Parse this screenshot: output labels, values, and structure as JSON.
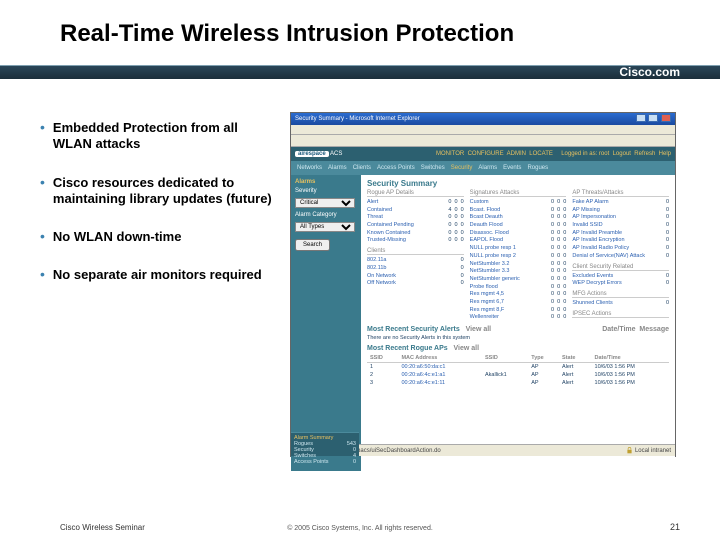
{
  "slide": {
    "title": "Real-Time Wireless Intrusion Protection",
    "cisco_com": "Cisco.com",
    "bullets": [
      "Embedded Protection from all WLAN attacks",
      "Cisco resources dedicated to maintaining library updates (future)",
      "No WLAN down-time",
      "No separate air monitors required"
    ],
    "footer_left": "Cisco Wireless Seminar",
    "footer_center": "© 2005 Cisco Systems, Inc. All rights reserved.",
    "footer_right": "21"
  },
  "screenshot": {
    "window_title": "Security Summary - Microsoft Internet Explorer",
    "brand": "airespace",
    "brand_sub": "ACS",
    "login": "Logged in as: root",
    "logout": "Logout",
    "refresh": "Refresh",
    "help": "Help",
    "topnav": [
      "MONITOR",
      "CONFIGURE",
      "ADMIN",
      "LOCATE"
    ],
    "subnav": [
      "Networks",
      "Alarms",
      "Clients",
      "Access Points",
      "Switches",
      "Security",
      "Alarms",
      "Events",
      "Rogues"
    ],
    "left": {
      "header": "Alarms",
      "severity_label": "Severity",
      "severity_value": "Critical",
      "category_label": "Alarm Category",
      "category_value": "All Types",
      "search": "Search"
    },
    "summary": {
      "title": "Security Summary",
      "col1_hdr": "Rogue AP Details",
      "col2_hdr": "Signatures Attacks",
      "col3_hdr": "AP Threats/Attacks",
      "col1": [
        {
          "l": "Alert",
          "a": "0",
          "b": "0",
          "c": "0"
        },
        {
          "l": "Contained",
          "a": "4",
          "b": "0",
          "c": "0"
        },
        {
          "l": "Threat",
          "a": "0",
          "b": "0",
          "c": "0"
        },
        {
          "l": "Contained Pending",
          "a": "0",
          "b": "0",
          "c": "0"
        },
        {
          "l": "Known Contained",
          "a": "0",
          "b": "0",
          "c": "0"
        },
        {
          "l": "Trusted-Missing",
          "a": "0",
          "b": "0",
          "c": "0"
        }
      ],
      "col1b_hdr": "Clients",
      "col1b": [
        {
          "l": "802.11a",
          "a": "0"
        },
        {
          "l": "802.11b",
          "a": "0"
        },
        {
          "l": "On Network",
          "a": "0"
        },
        {
          "l": "Off Network",
          "a": "0"
        }
      ],
      "col2": [
        {
          "l": "Custom",
          "a": "0",
          "b": "0",
          "c": "0"
        },
        {
          "l": "Bcast. Flood",
          "a": "0",
          "b": "0",
          "c": "0"
        },
        {
          "l": "Bcast Deauth",
          "a": "0",
          "b": "0",
          "c": "0"
        },
        {
          "l": "Deauth Flood",
          "a": "0",
          "b": "0",
          "c": "0"
        },
        {
          "l": "Disassoc. Flood",
          "a": "0",
          "b": "0",
          "c": "0"
        },
        {
          "l": "EAPOL Flood",
          "a": "0",
          "b": "0",
          "c": "0"
        },
        {
          "l": "NULL probe resp 1",
          "a": "0",
          "b": "0",
          "c": "0"
        },
        {
          "l": "NULL probe resp 2",
          "a": "0",
          "b": "0",
          "c": "0"
        },
        {
          "l": "NetStumbler 3.2",
          "a": "0",
          "b": "0",
          "c": "0"
        },
        {
          "l": "NetStumbler 3.3",
          "a": "0",
          "b": "0",
          "c": "0"
        },
        {
          "l": "NetStumbler generic",
          "a": "0",
          "b": "0",
          "c": "0"
        },
        {
          "l": "Probe flood",
          "a": "0",
          "b": "0",
          "c": "0"
        },
        {
          "l": "Res mgmt 4,5",
          "a": "0",
          "b": "0",
          "c": "0"
        },
        {
          "l": "Res mgmt 6,7",
          "a": "0",
          "b": "0",
          "c": "0"
        },
        {
          "l": "Res mgmt 8,F",
          "a": "0",
          "b": "0",
          "c": "0"
        },
        {
          "l": "Wellenreiter",
          "a": "0",
          "b": "0",
          "c": "0"
        }
      ],
      "col3": [
        {
          "l": "Fake AP Alarm",
          "v": "0"
        },
        {
          "l": "AP Missing",
          "v": "0"
        },
        {
          "l": "AP Impersonation",
          "v": "0"
        },
        {
          "l": "Invalid SSID",
          "v": "0"
        },
        {
          "l": "AP Invalid Preamble",
          "v": "0"
        },
        {
          "l": "AP Invalid Encryption",
          "v": "0"
        },
        {
          "l": "AP Invalid Radio Policy",
          "v": "0"
        },
        {
          "l": "Denial of Service(NAV) Attack",
          "v": "0"
        }
      ],
      "col3b_hdr": "Client Security Related",
      "col3b": [
        {
          "l": "Excluded Events",
          "v": "0"
        },
        {
          "l": "WEP Decrypt Errors",
          "v": "0"
        }
      ],
      "col3c_hdr": "MFG Actions",
      "col3c": [
        {
          "l": "Shunned Clients",
          "v": "0"
        }
      ],
      "col3d_hdr": "IPSEC Actions"
    },
    "alerts": {
      "header": "Most Recent Security Alerts",
      "filter": "View all",
      "note": "There are no Security Alerts in this system",
      "rogues_header": "Most Recent Rogue APs",
      "view_all": "View all",
      "table_headers": [
        "SSID",
        "MAC Address",
        "SSID",
        "Type",
        "State",
        "Date/Time"
      ],
      "rows": [
        {
          "ssid_n": "1",
          "mac": "00:20:a6:50:da:c1",
          "ssid": "",
          "type": "AP",
          "state": "Alert",
          "dt": "10/6/03 1:56 PM"
        },
        {
          "ssid_n": "2",
          "mac": "00:20:a6:4c:e1:a1",
          "ssid": "Akallick1",
          "type": "AP",
          "state": "Alert",
          "dt": "10/6/03 1:56 PM"
        },
        {
          "ssid_n": "3",
          "mac": "00:20:a6:4c:e1:11",
          "ssid": "",
          "type": "AP",
          "state": "Alert",
          "dt": "10/6/03 1:56 PM"
        }
      ]
    },
    "bottom_left": {
      "header": "Alarm Summary",
      "rows": [
        {
          "l": "Rogues",
          "v": "543"
        },
        {
          "l": "Security",
          "v": "0"
        },
        {
          "l": "Switches",
          "v": "4"
        },
        {
          "l": "Access Points",
          "v": "0"
        }
      ]
    },
    "statusbar": "https://cubancar200/webacs/uiSecDashboardAction.do",
    "status_right": "Local intranet"
  }
}
